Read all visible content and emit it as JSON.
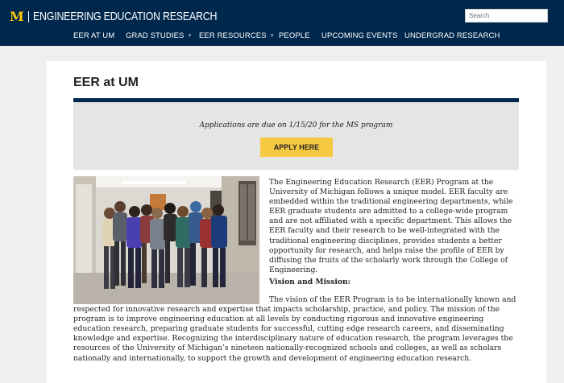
{
  "header": {
    "logo_mark": "M",
    "site_title": "ENGINEERING EDUCATION RESEARCH",
    "search_placeholder": "Search"
  },
  "nav": {
    "items": [
      {
        "label": "EER AT UM",
        "has_dropdown": false
      },
      {
        "label": "GRAD STUDIES",
        "has_dropdown": true
      },
      {
        "label": "EER RESOURCES",
        "has_dropdown": true
      },
      {
        "label": "PEOPLE",
        "has_dropdown": false
      },
      {
        "label": "UPCOMING EVENTS",
        "has_dropdown": false
      },
      {
        "label": "UNDERGRAD RESEARCH",
        "has_dropdown": false
      }
    ]
  },
  "page": {
    "title": "EER at UM",
    "banner_text": "Applications are due on 1/15/20 for the MS program",
    "apply_label": "APPLY HERE",
    "intro": "The Engineering Education Research (EER) Program at the University of Michigan follows a unique model. EER faculty are embedded within the traditional engineering departments, while EER graduate students are admitted to a college-wide program and are not affiliated with a specific department. This allows the EER faculty and their research to be well-integrated with the traditional engineering disciplines, provides students a better opportunity for research, and helps raise the profile of EER by diffusing the fruits of the scholarly work through the College of Engineering.",
    "vision_heading": "Vision and Mission:",
    "vision_text": "The vision of the EER Program is to be internationally known and respected for innovative research and expertise that impacts scholarship, practice, and policy. The mission of the program is to improve engineering education at all levels by conducting rigorous and innovative engineering education research, preparing graduate students for successful, cutting edge research careers, and disseminating knowledge and expertise. Recognizing the interdisciplinary nature of education research, the program leverages the resources of the University of Michigan’s nineteen nationally-recognized schools and colleges, as well as scholars nationally and internationally, to support the growth and development of engineering education research."
  },
  "colors": {
    "navy": "#00274c",
    "maize": "#ffcb05",
    "button": "#f7c842",
    "banner_bg": "#e5e5e5"
  },
  "icons": {
    "dropdown": "chevron-down-icon"
  }
}
